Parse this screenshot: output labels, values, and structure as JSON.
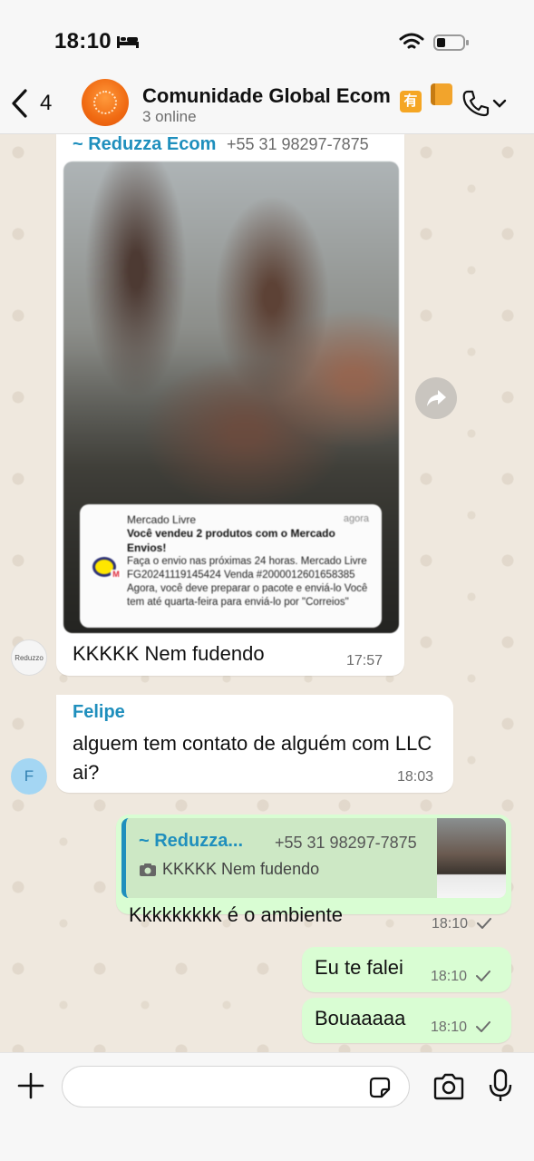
{
  "status_bar": {
    "time": "18:10"
  },
  "header": {
    "back_count": "4",
    "title": "Comunidade Global Ecom",
    "title_emoji_1": "有",
    "status": "3 online"
  },
  "messages": [
    {
      "sender": "~ Reduzza Ecom",
      "phone": "+55 31 98297-7875",
      "avatar_label": "Reduzzo",
      "notification": {
        "app": "Mercado Livre",
        "time": "agora",
        "title": "Você vendeu 2 produtos com o Mercado Envios!",
        "body": "Faça o envio nas próximas 24 horas. Mercado Livre FG20241119145424 Venda #2000012601658385 Agora, você deve preparar o pacote e enviá-lo Você tem até quarta-feira para enviá-lo por \"Correios\""
      },
      "text": "KKKKK Nem fudendo",
      "time": "17:57"
    },
    {
      "sender": "Felipe",
      "avatar_initial": "F",
      "text": "alguem tem contato de alguém com LLC ai?",
      "time": "18:03"
    },
    {
      "quote_sender": "~ Reduzza...",
      "quote_phone": "+55 31 98297-7875",
      "quote_text": "KKKKK Nem fudendo",
      "text": "Kkkkkkkkk é o ambiente",
      "time": "18:10"
    },
    {
      "text": "Eu te falei",
      "time": "18:10"
    },
    {
      "text": "Bouaaaaa",
      "time": "18:10"
    }
  ],
  "input": {
    "placeholder": ""
  },
  "colors": {
    "accent_blue": "#1f8fbd",
    "outgoing_bubble": "#d9fdd3",
    "chat_background": "#efe8de",
    "read_check": "#53bdeb"
  },
  "icons": [
    "bed-icon",
    "wifi-icon",
    "battery-icon",
    "back-chevron-icon",
    "phone-icon",
    "chevron-down-icon",
    "forward-icon",
    "camera-icon",
    "plus-icon",
    "sticker-icon",
    "mic-icon",
    "check-icon"
  ]
}
